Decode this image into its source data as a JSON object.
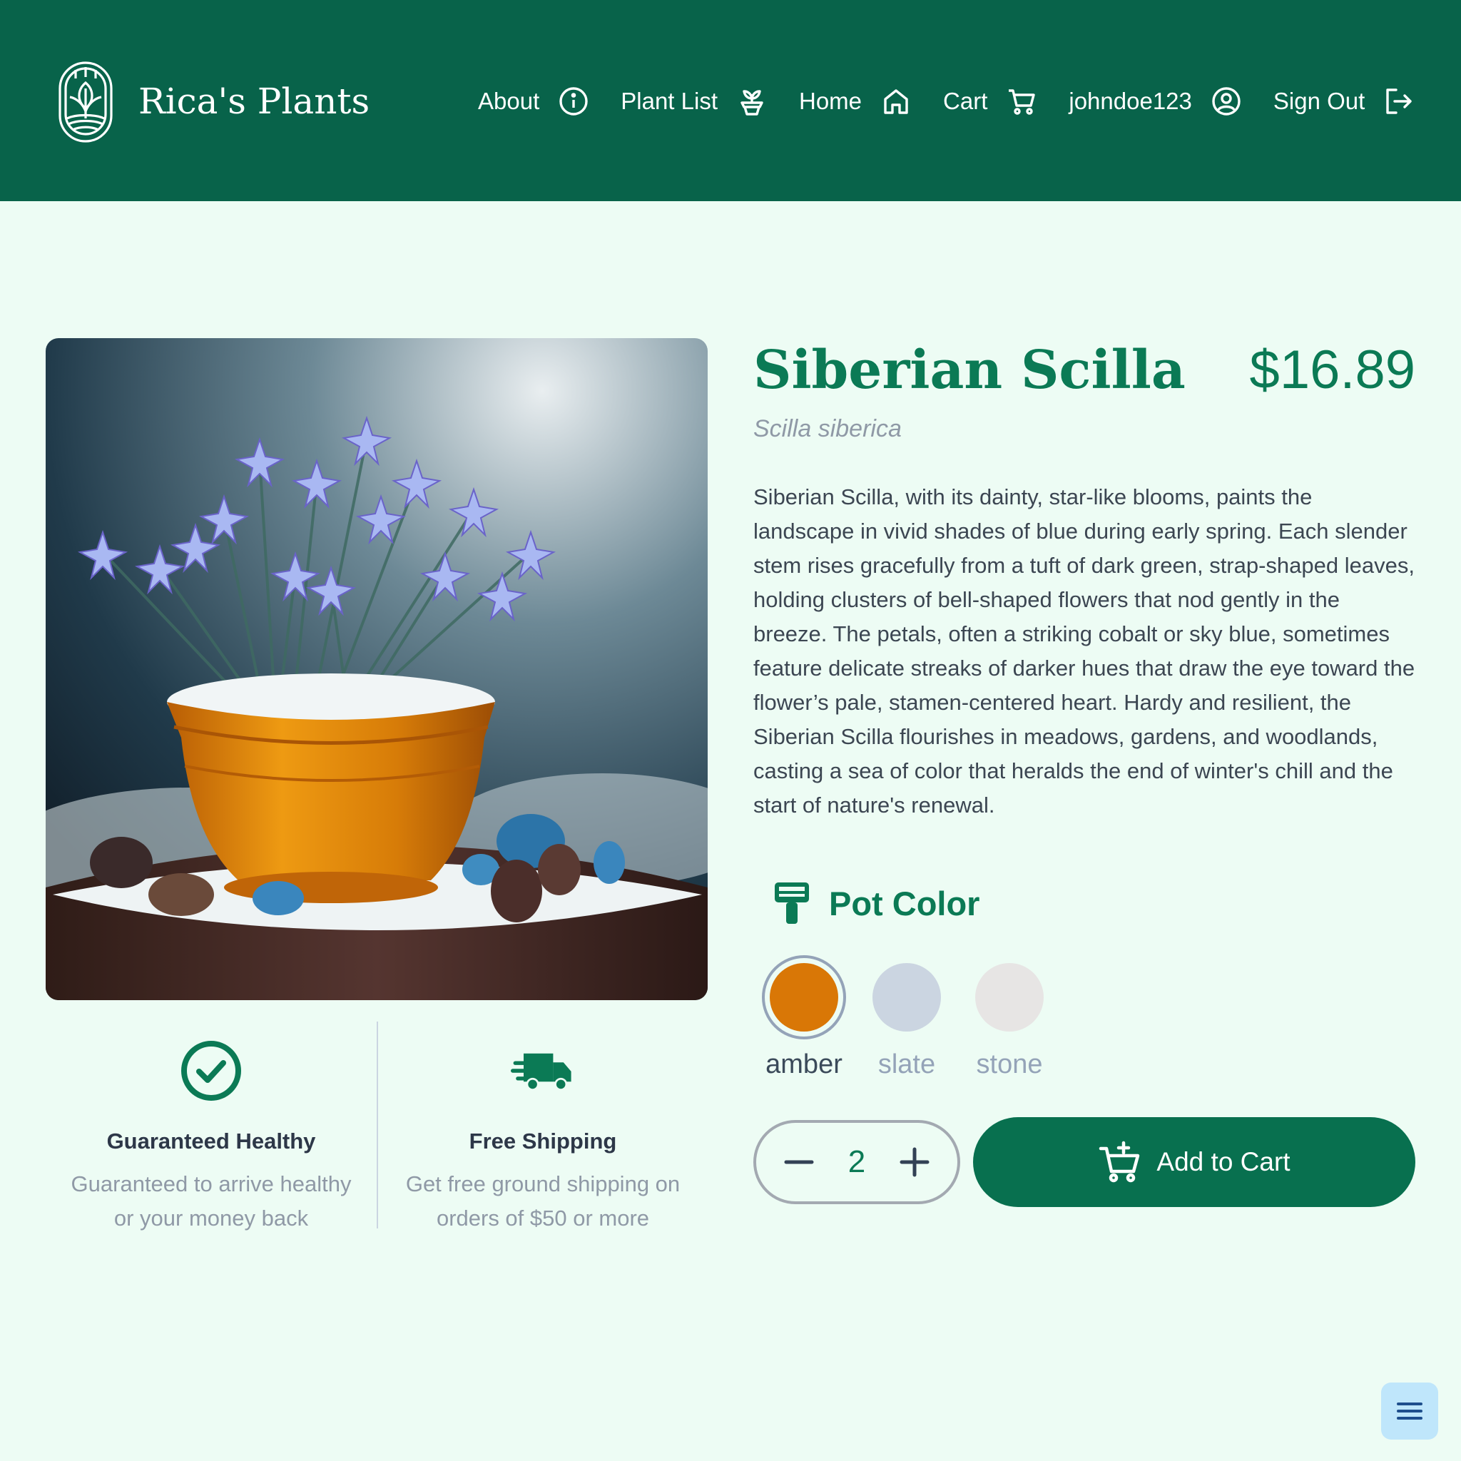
{
  "brand": {
    "name": "Rica's Plants",
    "logo_icon": "leaf-shield-logo"
  },
  "nav": {
    "items": [
      {
        "label": "About",
        "icon": "info-icon"
      },
      {
        "label": "Plant List",
        "icon": "plant-pot-icon"
      },
      {
        "label": "Home",
        "icon": "home-icon"
      },
      {
        "label": "Cart",
        "icon": "cart-icon"
      },
      {
        "label": "johndoe123",
        "icon": "user-circle-icon"
      },
      {
        "label": "Sign Out",
        "icon": "sign-out-icon"
      }
    ]
  },
  "product": {
    "name": "Siberian Scilla",
    "price": "$16.89",
    "botanical_name": "Scilla siberica",
    "description": "Siberian Scilla, with its dainty, star-like blooms, paints the landscape in vivid shades of blue during early spring. Each slender stem rises gracefully from a tuft of dark green, strap-shaped leaves, holding clusters of bell-shaped flowers that nod gently in the breeze. The petals, often a striking cobalt or sky blue, sometimes feature delicate streaks of darker hues that draw the eye toward the flower’s pale, stamen-centered heart. Hardy and resilient, the Siberian Scilla flourishes in meadows, gardens, and woodlands, casting a sea of color that heralds the end of winter's chill and the start of nature's renewal.",
    "image_alt": "Blue star-shaped flowers in an amber pot on a snowy tree stump"
  },
  "pot_color": {
    "label": "Pot Color",
    "icon": "paint-brush-icon",
    "options": [
      {
        "name": "amber",
        "color": "#d97706",
        "selected": true
      },
      {
        "name": "slate",
        "color": "#cbd5e1",
        "selected": false
      },
      {
        "name": "stone",
        "color": "#e7e5e4",
        "selected": false
      }
    ]
  },
  "cart": {
    "quantity": "2",
    "add_label": "Add to Cart"
  },
  "features": [
    {
      "icon": "check-circle-icon",
      "title": "Guaranteed Healthy",
      "text": "Guaranteed to arrive healthy or your money back"
    },
    {
      "icon": "delivery-truck-icon",
      "title": "Free Shipping",
      "text": "Get free ground shipping on orders of $50 or more"
    }
  ],
  "colors": {
    "header_bg": "#08634a",
    "page_bg": "#edfcf4",
    "accent": "#0b7a55",
    "button_bg": "#08704f",
    "menu_button_bg": "#bfe6fb"
  }
}
